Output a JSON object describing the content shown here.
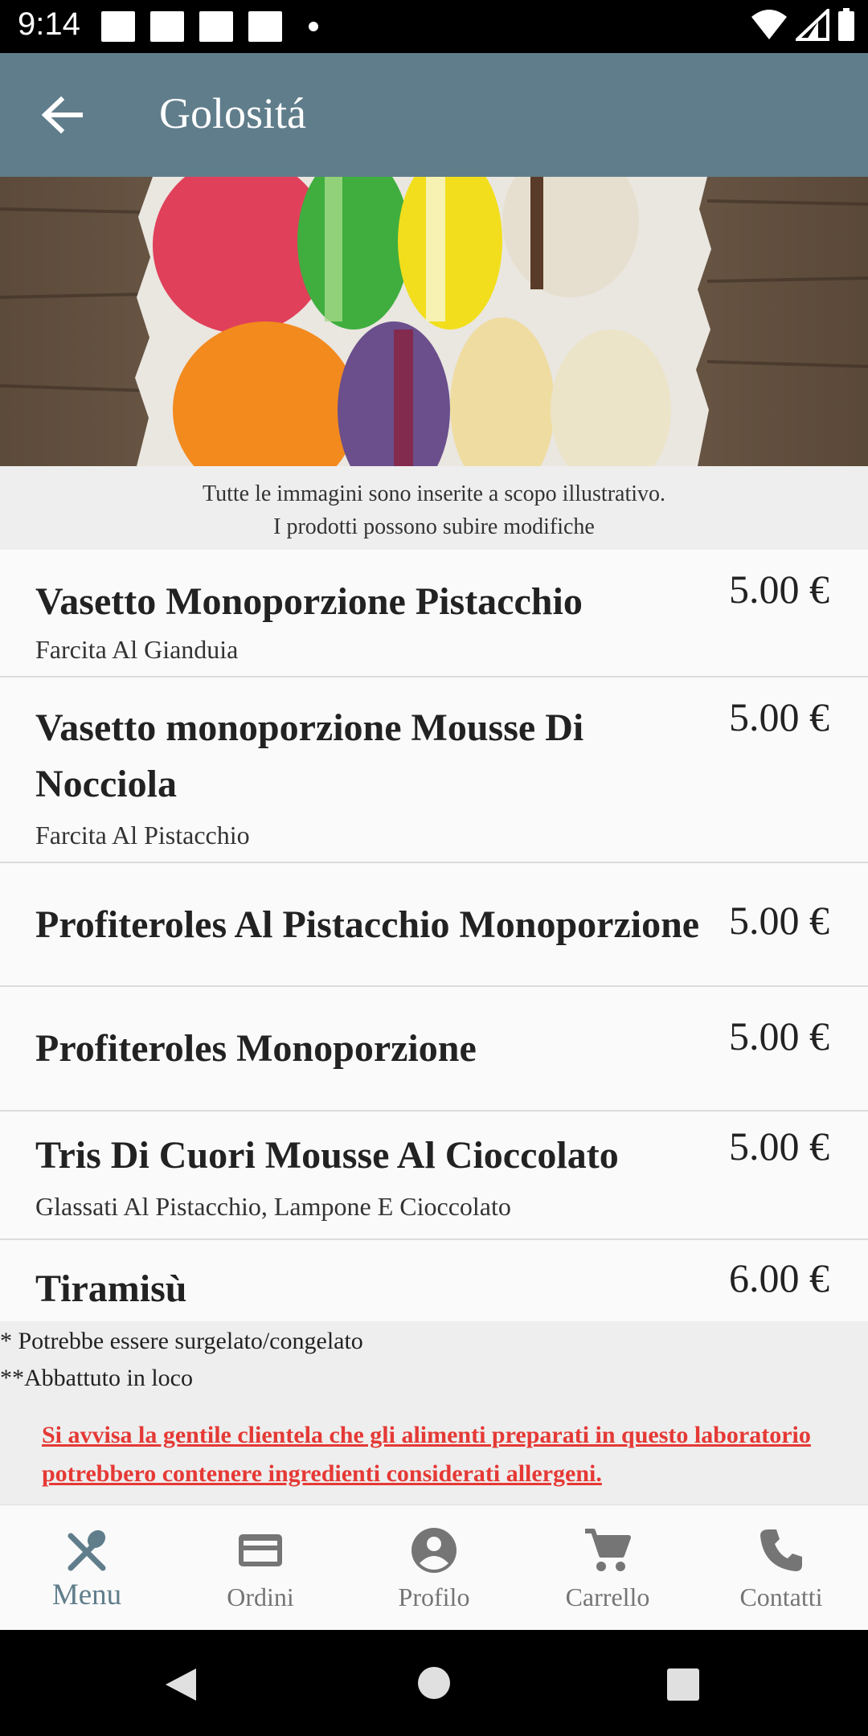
{
  "status_bar": {
    "time": "9:14"
  },
  "app_bar": {
    "title": "Golositá",
    "back_icon": "arrow-back-icon"
  },
  "hero": {
    "alt": "macarons"
  },
  "disclaimer": {
    "line1": "Tutte le immagini sono inserite a scopo illustrativo.",
    "line2": "I prodotti possono subire modifiche"
  },
  "menu": {
    "items": [
      {
        "name": "Vasetto Monoporzione Pistacchio",
        "price": "5.00 €",
        "description": "Farcita Al Gianduia"
      },
      {
        "name": "Vasetto monoporzione Mousse Di Nocciola",
        "price": "5.00 €",
        "description": "Farcita Al Pistacchio"
      },
      {
        "name": "Profiteroles Al Pistacchio Monoporzione",
        "price": "5.00 €",
        "description": ""
      },
      {
        "name": "Profiteroles Monoporzione",
        "price": "5.00 €",
        "description": ""
      },
      {
        "name": "Tris Di Cuori Mousse Al Cioccolato",
        "price": "5.00 €",
        "description": "Glassati Al Pistacchio, Lampone E Cioccolato"
      },
      {
        "name": "Tiramisù",
        "price": "6.00 €",
        "description": ""
      }
    ]
  },
  "notes": {
    "frozen": "* Potrebbe essere surgelato/congelato",
    "chilled": "**Abbattuto in loco",
    "allergen_warning": "Si avvisa la gentile clientela che gli alimenti preparati in questo laboratorio potrebbero contenere ingredienti considerati allergeni."
  },
  "bottom_nav": {
    "items": [
      {
        "label": "Menu",
        "icon": "cutlery-icon",
        "active": true
      },
      {
        "label": "Ordini",
        "icon": "credit-card-icon",
        "active": false
      },
      {
        "label": "Profilo",
        "icon": "account-circle-icon",
        "active": false
      },
      {
        "label": "Carrello",
        "icon": "shopping-cart-icon",
        "active": false
      },
      {
        "label": "Contatti",
        "icon": "phone-icon",
        "active": false
      }
    ]
  },
  "colors": {
    "app_bar": "#607d8b",
    "active_nav": "#607d8b",
    "inactive_nav": "#757575",
    "warning": "#e53935"
  }
}
